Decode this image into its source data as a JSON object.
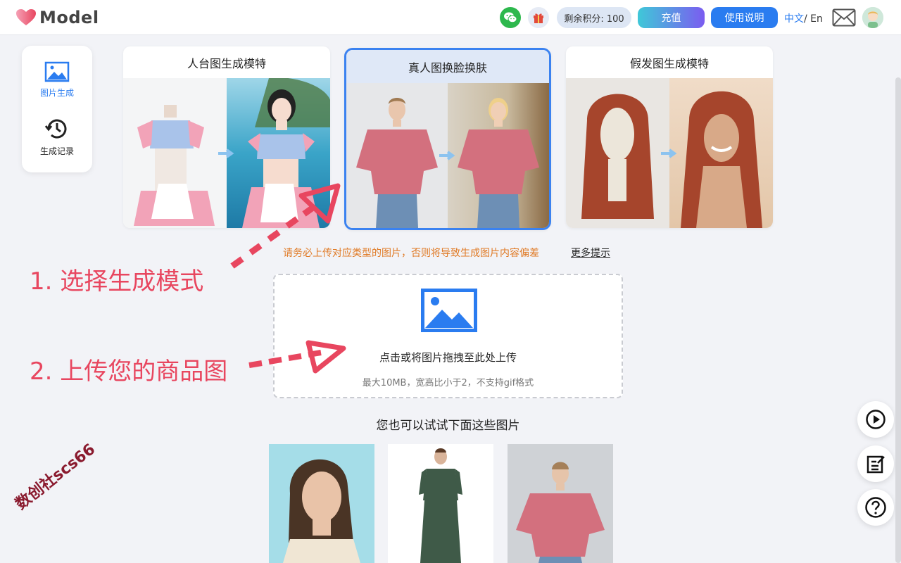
{
  "header": {
    "logo_text": "Model",
    "points_label": "剩余积分: 100",
    "recharge_label": "充值",
    "guide_label": "使用说明",
    "lang_zh": "中文",
    "lang_sep": "/ En"
  },
  "sidebar": {
    "items": [
      {
        "label": "图片生成",
        "icon": "image-icon",
        "active": true
      },
      {
        "label": "生成记录",
        "icon": "history-icon",
        "active": false
      }
    ]
  },
  "modes": [
    {
      "title": "人台图生成模特",
      "active": false
    },
    {
      "title": "真人图换脸换肤",
      "active": true
    },
    {
      "title": "假发图生成模特",
      "active": false
    }
  ],
  "hint": {
    "warning": "请务必上传对应类型的图片，否则将导致生成图片内容偏差",
    "more_tips": "更多提示"
  },
  "upload": {
    "main_text": "点击或将图片拖拽至此处上传",
    "sub_text": "最大10MB，宽高比小于2，不支持gif格式"
  },
  "annotations": {
    "step1": "1. 选择生成模式",
    "step2": "2. 上传您的商品图"
  },
  "samples": {
    "title": "您也可以试试下面这些图片"
  },
  "watermark": "数创社scs66",
  "colors": {
    "accent": "#2a7cf0",
    "warning": "#e07a25",
    "annotation": "#e8465f"
  }
}
